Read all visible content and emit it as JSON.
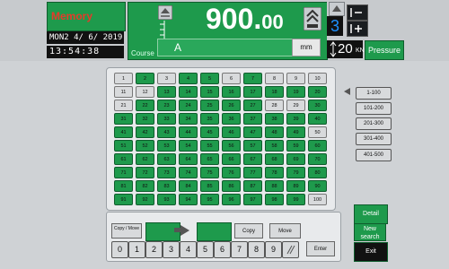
{
  "header": {
    "memory_label": "Memory",
    "date": "MON2 4/  6/ 2019",
    "time": "13:54:38",
    "course_value_int": "900.",
    "course_value_dec": "00",
    "course_label": "Course",
    "course_field_label": "A",
    "course_unit": "mm",
    "page_digit": "3",
    "kn_value": "20",
    "kn_unit": "KN",
    "pressure_label": "Pressure"
  },
  "grid": {
    "green_numbers": [
      2,
      4,
      5,
      7,
      13,
      14,
      15,
      16,
      17,
      18,
      19,
      20,
      22,
      23,
      24,
      25,
      26,
      27,
      30,
      31,
      32,
      33,
      34,
      35,
      36,
      37,
      38,
      39,
      40,
      41,
      42,
      43,
      44,
      45,
      46,
      47,
      48,
      49,
      51,
      52,
      53,
      54,
      55,
      56,
      57,
      58,
      59,
      60,
      61,
      62,
      63,
      64,
      65,
      66,
      67,
      68,
      69,
      70,
      71,
      72,
      73,
      74,
      75,
      76,
      77,
      78,
      79,
      80,
      81,
      82,
      83,
      84,
      85,
      86,
      87,
      88,
      89,
      90,
      91,
      92,
      93,
      94,
      95,
      96,
      97,
      98,
      99
    ],
    "cells": [
      "1",
      "2",
      "3",
      "4",
      "5",
      "6",
      "7",
      "8",
      "9",
      "10",
      "11",
      "12",
      "13",
      "14",
      "15",
      "16",
      "17",
      "18",
      "19",
      "20",
      "21",
      "22",
      "23",
      "24",
      "25",
      "26",
      "27",
      "28",
      "29",
      "30",
      "31",
      "32",
      "33",
      "34",
      "35",
      "36",
      "37",
      "38",
      "39",
      "40",
      "41",
      "42",
      "43",
      "44",
      "45",
      "46",
      "47",
      "48",
      "49",
      "50",
      "51",
      "52",
      "53",
      "54",
      "55",
      "56",
      "57",
      "58",
      "59",
      "60",
      "61",
      "62",
      "63",
      "64",
      "65",
      "66",
      "67",
      "68",
      "69",
      "70",
      "71",
      "72",
      "73",
      "74",
      "75",
      "76",
      "77",
      "78",
      "79",
      "80",
      "81",
      "82",
      "83",
      "84",
      "85",
      "86",
      "87",
      "88",
      "89",
      "90",
      "91",
      "92",
      "93",
      "94",
      "95",
      "96",
      "97",
      "98",
      "99",
      "100"
    ]
  },
  "ranges": [
    "1-100",
    "101-200",
    "201-300",
    "301-400",
    "401-500"
  ],
  "bottom": {
    "copy_move_label": "Copy / Move",
    "copy_label": "Copy",
    "move_label": "Move",
    "enter_label": "Enter",
    "keys": [
      "0",
      "1",
      "2",
      "3",
      "4",
      "5",
      "6",
      "7",
      "8",
      "9",
      "/"
    ]
  },
  "side": {
    "detail_label": "Detail",
    "new_search_label": "New search",
    "exit_label": "Exit"
  },
  "colors": {
    "accent": "#1e9a4c",
    "exit_bg": "#111111",
    "background": "#cfd2d5"
  }
}
